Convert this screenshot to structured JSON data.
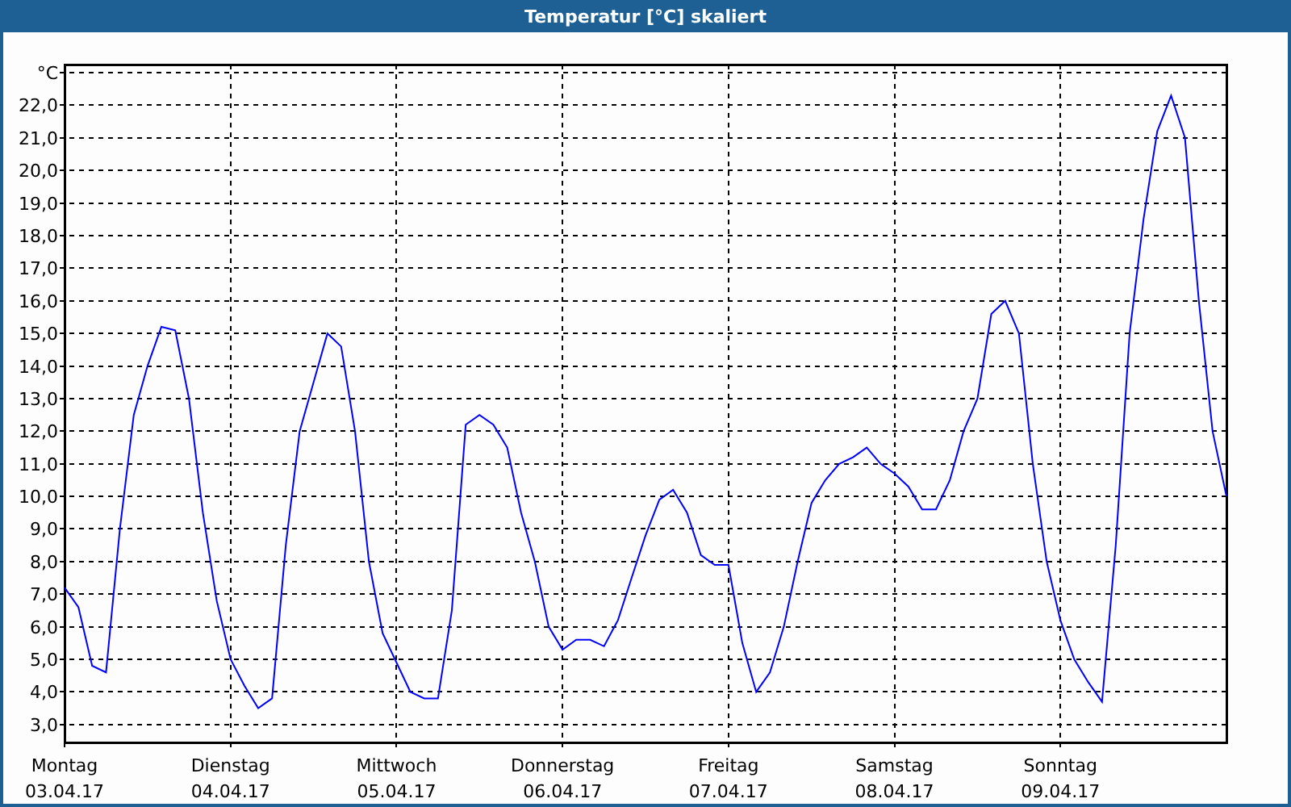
{
  "window": {
    "title": "Temperatur [°C] skaliert"
  },
  "chart": {
    "chart_data": {
      "type": "line",
      "categories": [
        "Montag",
        null,
        null,
        null,
        null,
        null,
        null,
        null,
        null,
        null,
        null,
        null,
        "Dienstag",
        null,
        null,
        null,
        null,
        null,
        null,
        null,
        null,
        null,
        null,
        null,
        "Mittwoch",
        null,
        null,
        null,
        null,
        null,
        null,
        null,
        null,
        null,
        null,
        null,
        "Donnerstag",
        null,
        null,
        null,
        null,
        null,
        null,
        null,
        null,
        null,
        null,
        null,
        "Freitag",
        null,
        null,
        null,
        null,
        null,
        null,
        null,
        null,
        null,
        null,
        null,
        "Samstag",
        null,
        null,
        null,
        null,
        null,
        null,
        null,
        null,
        null,
        null,
        null,
        "Sonntag",
        null,
        null,
        null,
        null,
        null,
        null,
        null,
        null,
        null,
        null,
        null,
        null
      ],
      "series": [
        {
          "color": "#0000ff",
          "values": [
            7.2,
            6.6,
            4.8,
            4.6,
            9.0,
            12.5,
            14.0,
            15.2,
            15.1,
            13.0,
            9.5,
            6.8,
            5.0,
            4.2,
            3.5,
            3.8,
            8.5,
            12.0,
            13.5,
            15.0,
            14.6,
            12.0,
            8.0,
            5.8,
            4.9,
            4.0,
            3.8,
            3.8,
            6.5,
            12.2,
            12.5,
            12.2,
            11.5,
            9.5,
            8.0,
            6.0,
            5.3,
            5.6,
            5.6,
            5.4,
            6.2,
            7.5,
            8.8,
            9.9,
            10.2,
            9.5,
            8.2,
            7.9,
            7.9,
            5.5,
            4.0,
            4.6,
            6.0,
            8.0,
            9.8,
            10.5,
            11.0,
            11.2,
            11.5,
            11.0,
            10.7,
            10.3,
            9.6,
            9.6,
            10.5,
            12.0,
            13.0,
            15.6,
            16.0,
            15.0,
            11.0,
            8.0,
            6.2,
            5.0,
            4.3,
            3.7,
            8.5,
            15.0,
            18.5,
            21.2,
            22.3,
            21.0,
            16.0,
            12.0,
            10.0
          ]
        }
      ],
      "ylim": [
        2.45,
        23.25
      ],
      "grid": true,
      "yticks": [
        {
          "value": 3,
          "label": "3,0"
        },
        {
          "value": 4,
          "label": "4,0"
        },
        {
          "value": 5,
          "label": "5,0"
        },
        {
          "value": 6,
          "label": "6,0"
        },
        {
          "value": 7,
          "label": "7,0"
        },
        {
          "value": 8,
          "label": "8,0"
        },
        {
          "value": 9,
          "label": "9,0"
        },
        {
          "value": 10,
          "label": "10,0"
        },
        {
          "value": 11,
          "label": "11,0"
        },
        {
          "value": 12,
          "label": "12,0"
        },
        {
          "value": 13,
          "label": "13,0"
        },
        {
          "value": 14,
          "label": "14,0"
        },
        {
          "value": 15,
          "label": "15,0"
        },
        {
          "value": 16,
          "label": "16,0"
        },
        {
          "value": 17,
          "label": "17,0"
        },
        {
          "value": 18,
          "label": "18,0"
        },
        {
          "value": 19,
          "label": "19,0"
        },
        {
          "value": 20,
          "label": "20,0"
        },
        {
          "value": 21,
          "label": "21,0"
        },
        {
          "value": 22,
          "label": "22,0"
        },
        {
          "value": 23,
          "label": "°C"
        }
      ]
    },
    "dates": [
      "03.04.17",
      "04.04.17",
      "05.04.17",
      "06.04.17",
      "07.04.17",
      "08.04.17",
      "09.04.17"
    ]
  }
}
